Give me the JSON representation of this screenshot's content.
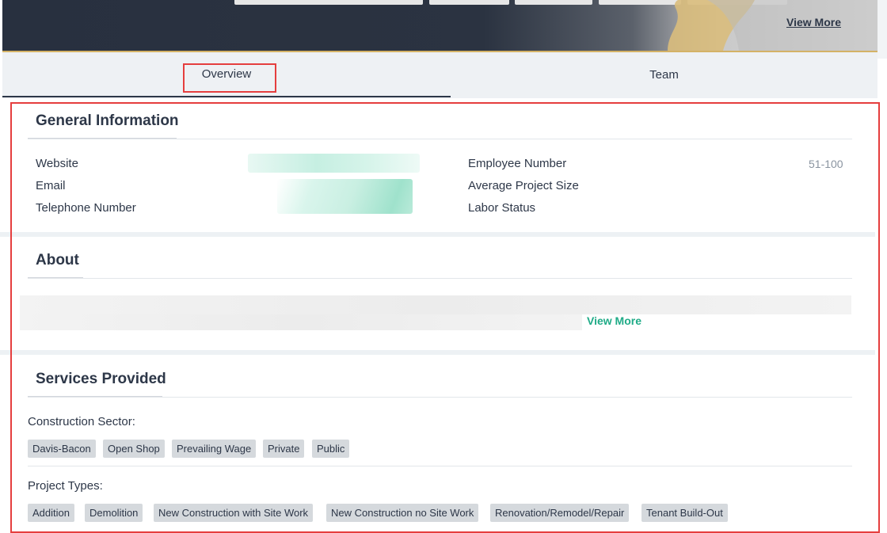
{
  "hero": {
    "view_more_label": "View More"
  },
  "tabs": [
    {
      "label": "Overview",
      "active": true
    },
    {
      "label": "Team",
      "active": false
    }
  ],
  "general_information": {
    "title": "General Information",
    "left_fields": [
      {
        "label": "Website"
      },
      {
        "label": "Email"
      },
      {
        "label": "Telephone Number"
      }
    ],
    "right_fields": [
      {
        "label": "Employee Number",
        "value": "51-100"
      },
      {
        "label": "Average Project Size",
        "value": ""
      },
      {
        "label": "Labor Status",
        "value": ""
      }
    ]
  },
  "about": {
    "title": "About",
    "view_more_label": "View More"
  },
  "services": {
    "title": "Services Provided",
    "construction_sector": {
      "label": "Construction Sector:",
      "items": [
        "Davis-Bacon",
        "Open Shop",
        "Prevailing Wage",
        "Private",
        "Public"
      ]
    },
    "project_types": {
      "label": "Project Types:",
      "items": [
        "Addition",
        "Demolition",
        "New Construction with Site Work",
        "New Construction no Site Work",
        "Renovation/Remodel/Repair",
        "Tenant Build-Out"
      ]
    }
  },
  "colors": {
    "accent_green": "#1fab87",
    "highlight_red": "#e53e3e",
    "hero_dark": "#28303f",
    "hero_gold": "#d4b266",
    "chip_bg": "#d5d9dd"
  }
}
